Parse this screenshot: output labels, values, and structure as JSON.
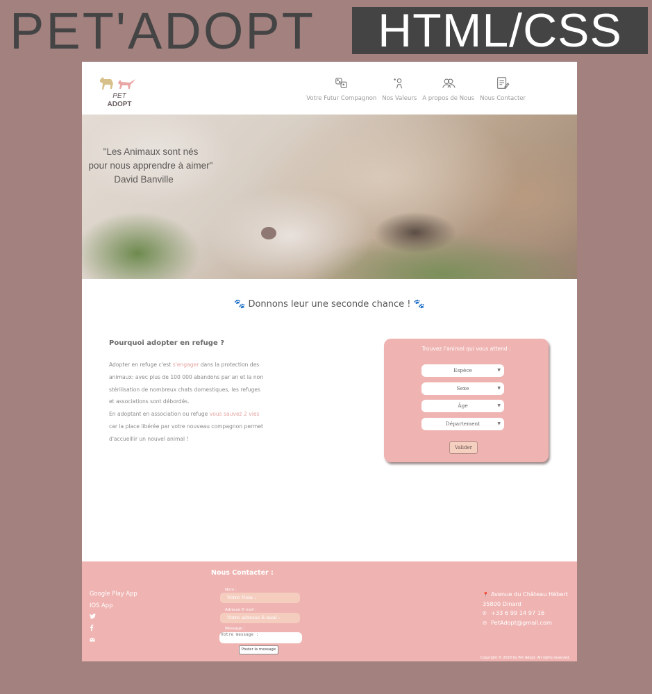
{
  "banner": {
    "brand": "PET'ADOPT",
    "tech": "HTML/CSS"
  },
  "site": {
    "logo": {
      "line1": "PET",
      "line2": "ADOPT"
    },
    "nav": [
      {
        "label": "Votre Futur Compagnon",
        "icon": "pets-icon"
      },
      {
        "label": "Nos Valeurs",
        "icon": "hand-paw-icon"
      },
      {
        "label": "A propos de Nous",
        "icon": "people-icon"
      },
      {
        "label": "Nous Contacter",
        "icon": "edit-note-icon"
      }
    ],
    "hero": {
      "quote_line1": "\"Les Animaux sont nés",
      "quote_line2": "pour nous apprendre à aimer\"",
      "quote_author": "David Banville"
    },
    "section_title": "Donnons leur une seconde chance !",
    "why": {
      "title": "Pourquoi adopter en refuge ?",
      "p1_a": "Adopter en refuge c'est ",
      "p1_hl": "s'engager",
      "p1_b": " dans la protection des animaux: avec plus de 100 000 abandons par an et la non stérilisation de nombreux chats domestiques, les refuges et associations sont débordés.",
      "p2_a": "En adoptant en association ou refuge ",
      "p2_hl": "vous sauvez 2 vies",
      "p2_b": " car la place libérée par votre nouveau compagnon permet d'accueillir un nouvel animal !"
    },
    "search": {
      "title": "Trouvez l'animal qui vous attend :",
      "selects": [
        "Espèce",
        "Sexe",
        "Âge",
        "Département"
      ],
      "submit": "Valider"
    },
    "footer": {
      "contact_title": "Nous Contacter :",
      "links": [
        "Google Play App",
        "IOS App"
      ],
      "social_icons": [
        "twitter-icon",
        "facebook-icon",
        "mail-icon"
      ],
      "form": {
        "name_label": "Nom :",
        "name_placeholder": "Votre Nom :",
        "email_label": "Adresse E-mail :",
        "email_placeholder": "Votre adresse E-mail :",
        "message_label": "Message :",
        "message_placeholder": "Votre message :",
        "submit": "Poster le message"
      },
      "address_line1": "Avenue du Château Hébert",
      "address_line2": "35800 Dinard",
      "phone": "+33 6 99 14 97 16",
      "email": "PetAdopt@gmail.com",
      "copyright": "Copyright © 2020 by Pet Adopt. All rights reserved."
    },
    "colors": {
      "background": "#a2817f",
      "accent_pink": "#efb4b2",
      "highlight": "#e3a3a0",
      "badge": "#444444"
    }
  }
}
